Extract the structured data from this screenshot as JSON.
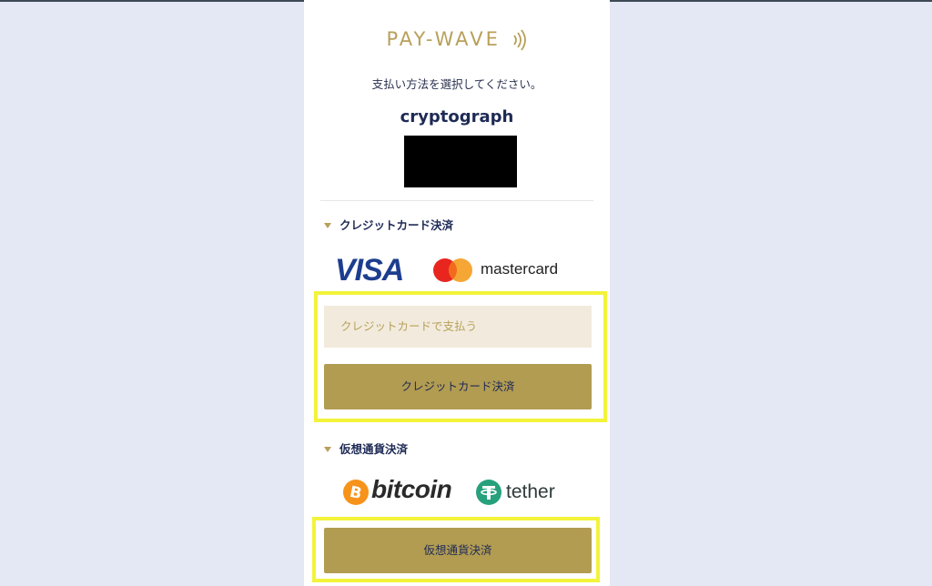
{
  "brand": {
    "logo_text": "PAY-WAVE",
    "accent": "#b8a05a"
  },
  "instruction": "支払い方法を選択してください。",
  "merchant_name": "cryptograph",
  "credit_section": {
    "title": "クレジットカード決済",
    "logos": {
      "visa": "VISA",
      "mastercard": "mastercard"
    },
    "input_placeholder": "クレジットカードで支払う",
    "button_label": "クレジットカード決済"
  },
  "crypto_section": {
    "title": "仮想通貨決済",
    "logos": {
      "bitcoin": "bitcoin",
      "tether": "tether"
    },
    "button_label": "仮想通貨決済"
  },
  "colors": {
    "button": "#b29c52",
    "input_bg": "#f2ebdd",
    "highlight": "#f3f33a",
    "text_navy": "#1e2a55"
  }
}
